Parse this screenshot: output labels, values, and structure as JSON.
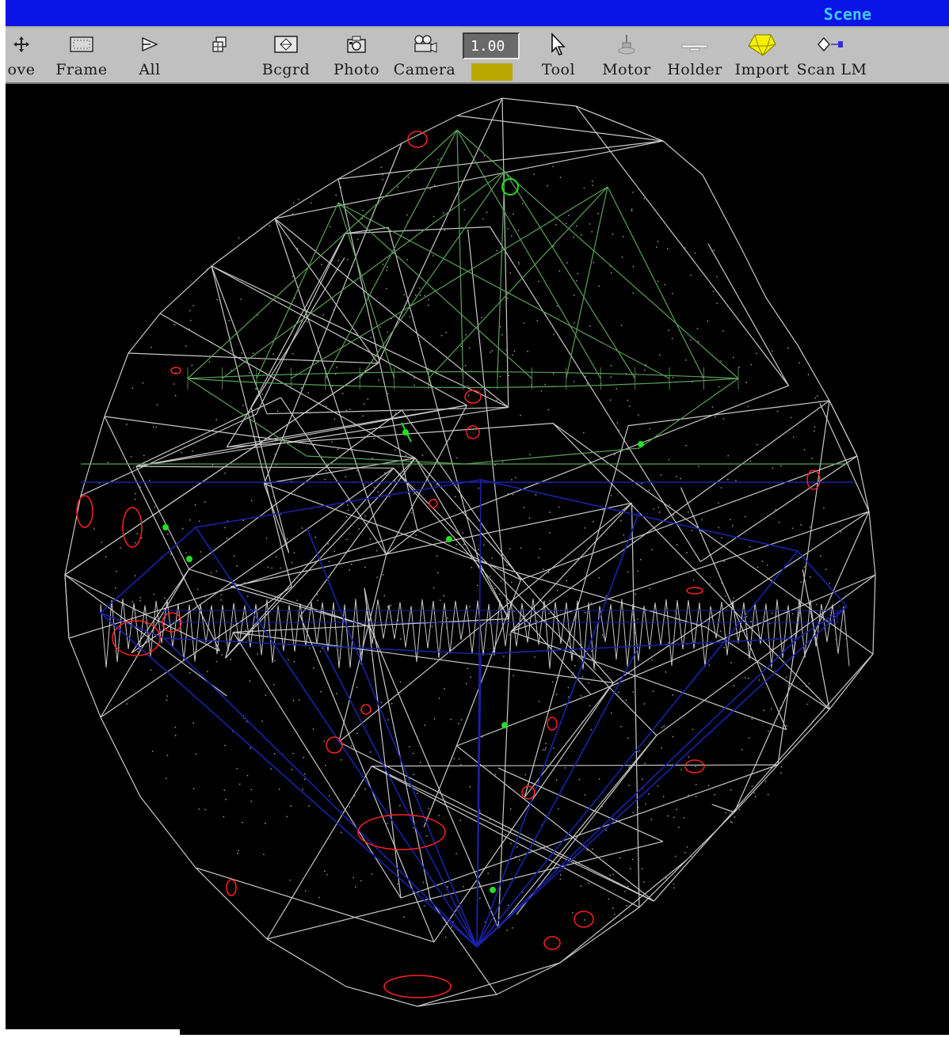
{
  "window": {
    "title": "Scene"
  },
  "toolbar": {
    "items": [
      {
        "label": "ove",
        "icon": "move-icon"
      },
      {
        "label": "Frame",
        "icon": "frame-icon"
      },
      {
        "label": "All",
        "icon": "all-icon"
      },
      {
        "label": "",
        "icon": "grid-icon"
      },
      {
        "label": "Bcgrd",
        "icon": "background-icon"
      },
      {
        "label": "Photo",
        "icon": "photo-icon"
      },
      {
        "label": "Camera",
        "icon": "camera-icon"
      },
      {
        "label": "Tool",
        "icon": "cursor-arrow-icon"
      },
      {
        "label": "Motor",
        "icon": "motor-icon"
      },
      {
        "label": "Holder",
        "icon": "holder-icon"
      },
      {
        "label": "Import",
        "icon": "import-icon"
      },
      {
        "label": "Scan LM",
        "icon": "scan-lm-icon"
      }
    ],
    "zoom_value": "1.00",
    "zoom_swatch_color": "#b8a800"
  },
  "colors": {
    "titlebar": "#0a14e6",
    "title_text": "#3ec8ff",
    "toolbar": "#c0c0c0",
    "viewport": "#000000",
    "outer_mesh": "#c8c8c8",
    "crown_wireframe": "#5aa05a",
    "pavilion_wireframe": "#1a22a8",
    "inclusions": "#ff2020",
    "inclusions_secondary": "#20e020"
  }
}
